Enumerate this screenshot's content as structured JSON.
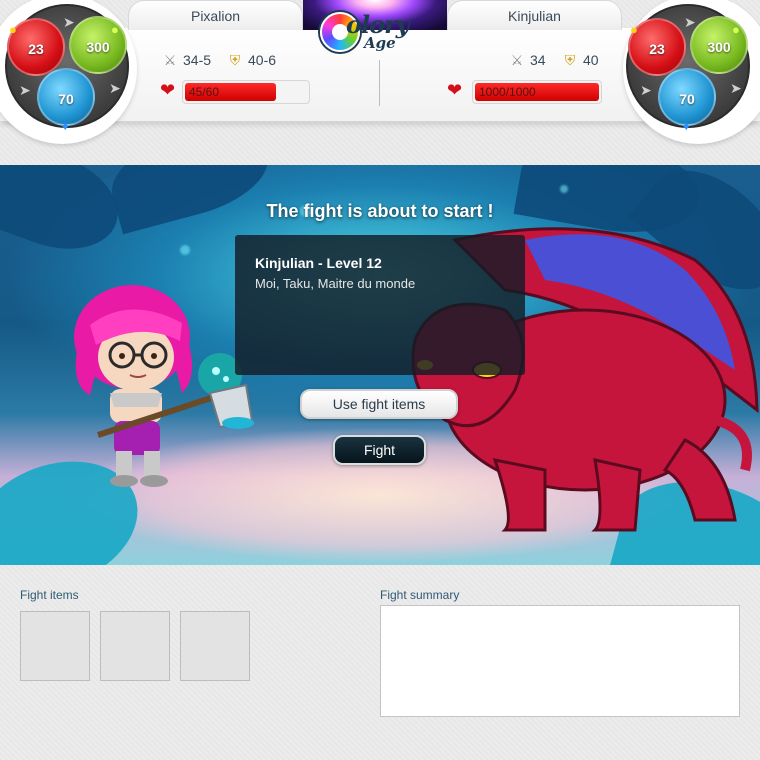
{
  "header": {
    "logo_text": "Colory Age",
    "left_player": {
      "name": "Pixalion",
      "attack": "34-5",
      "defense": "40-6",
      "hp_text": "45/60",
      "hp_fraction": 0.75,
      "orbs": {
        "red": "23",
        "green": "300",
        "blue": "70"
      }
    },
    "right_player": {
      "name": "Kinjulian",
      "attack": "34",
      "defense": "40",
      "hp_text": "1000/1000",
      "hp_fraction": 1.0,
      "orbs": {
        "red": "23",
        "green": "300",
        "blue": "70"
      }
    }
  },
  "scene": {
    "title": "The fight is about to start !",
    "opponent_name": "Kinjulian - Level 12",
    "opponent_title": "Moi, Taku, Maitre du monde",
    "use_items_label": "Use fight items",
    "fight_label": "Fight"
  },
  "bottom": {
    "items_label": "Fight items",
    "summary_label": "Fight summary"
  },
  "colors": {
    "hp_red": "#d40000",
    "orb_red": "#d40f15",
    "orb_green": "#77b91f",
    "orb_blue": "#1f94d2",
    "label_blue": "#2f5a74"
  },
  "icons": [
    "sword-icon",
    "shield-icon",
    "heart-icon",
    "coin-icon",
    "drop-icon"
  ]
}
